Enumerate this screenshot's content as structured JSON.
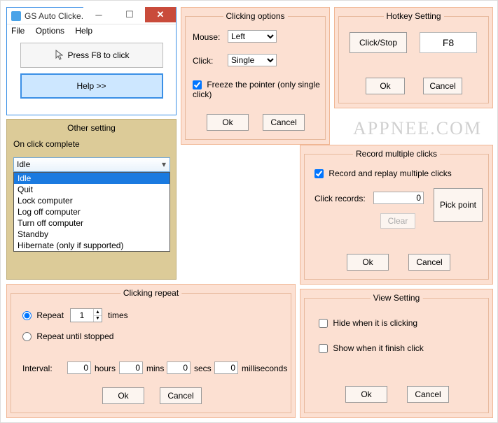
{
  "main": {
    "title": "GS Auto Clicke...",
    "menu": {
      "file": "File",
      "options": "Options",
      "help": "Help"
    },
    "pressBtn": "Press F8 to click",
    "helpBtn": "Help >>"
  },
  "clicking": {
    "title": "Clicking options",
    "mouseLbl": "Mouse:",
    "mouseVal": "Left",
    "clickLbl": "Click:",
    "clickVal": "Single",
    "freeze": "Freeze the pointer (only single click)",
    "ok": "Ok",
    "cancel": "Cancel"
  },
  "hotkey": {
    "title": "Hotkey Setting",
    "clickstop": "Click/Stop",
    "key": "F8",
    "ok": "Ok",
    "cancel": "Cancel"
  },
  "other": {
    "title": "Other setting",
    "onComplete": "On click complete",
    "selected": "Idle",
    "options": [
      "Idle",
      "Quit",
      "Lock computer",
      "Log off computer",
      "Turn off computer",
      "Standby",
      "Hibernate (only if supported)"
    ]
  },
  "repeat": {
    "title": "Clicking repeat",
    "repeatLbl": "Repeat",
    "repeatVal": "1",
    "timesLbl": "times",
    "untilLbl": "Repeat until stopped",
    "intervalLbl": "Interval:",
    "hours": "0",
    "hoursLbl": "hours",
    "mins": "0",
    "minsLbl": "mins",
    "secs": "0",
    "secsLbl": "secs",
    "ms": "0",
    "msLbl": "milliseconds",
    "ok": "Ok",
    "cancel": "Cancel"
  },
  "record": {
    "title": "Record multiple clicks",
    "chk": "Record and replay multiple clicks",
    "recLbl": "Click records:",
    "recVal": "0",
    "clear": "Clear",
    "pick": "Pick point",
    "ok": "Ok",
    "cancel": "Cancel"
  },
  "view": {
    "title": "View Setting",
    "hide": "Hide when it is clicking",
    "show": "Show when it finish click",
    "ok": "Ok",
    "cancel": "Cancel"
  },
  "watermark": "APPNEE.COM"
}
